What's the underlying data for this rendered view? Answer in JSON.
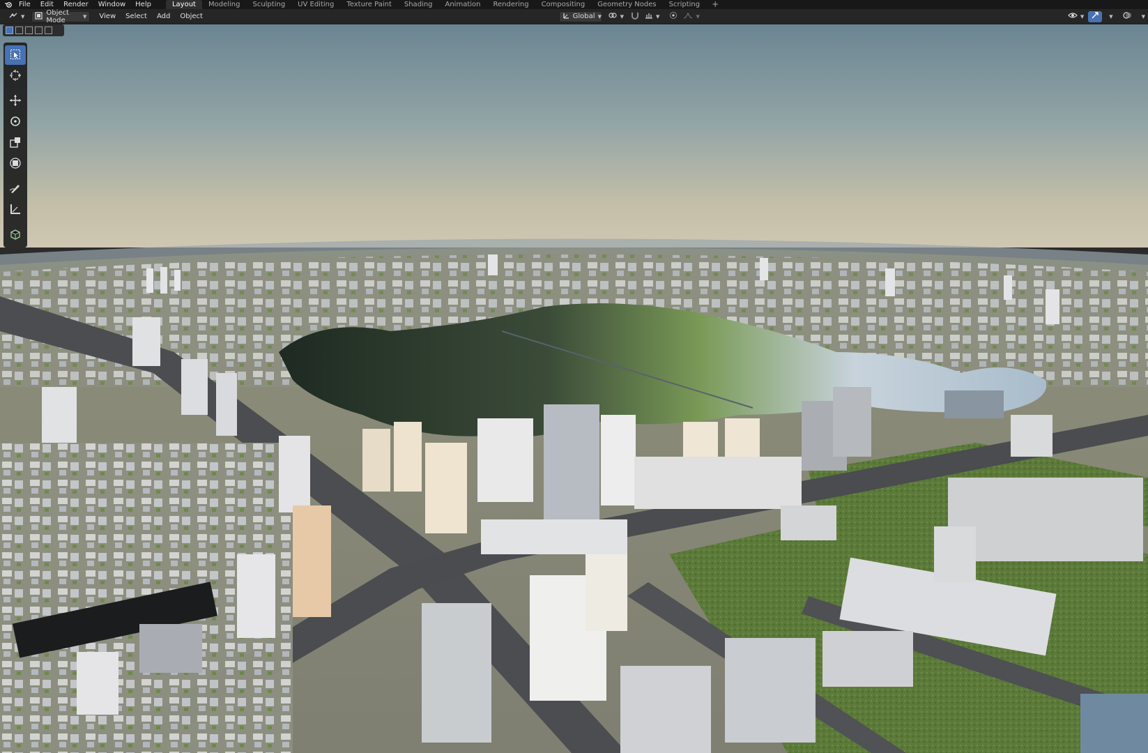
{
  "topbar": {
    "menus": [
      "File",
      "Edit",
      "Render",
      "Window",
      "Help"
    ],
    "workspaces": [
      "Layout",
      "Modeling",
      "Sculpting",
      "UV Editing",
      "Texture Paint",
      "Shading",
      "Animation",
      "Rendering",
      "Compositing",
      "Geometry Nodes",
      "Scripting"
    ],
    "active_workspace": "Layout",
    "add_label": "+"
  },
  "viewport_header": {
    "mode": "Object Mode",
    "menus": [
      "View",
      "Select",
      "Add",
      "Object"
    ],
    "orientation": "Global"
  },
  "toolshelf": {
    "tools": [
      "select-box",
      "cursor",
      "move",
      "rotate",
      "scale",
      "transform",
      "annotate",
      "measure",
      "add-cube"
    ],
    "active_tool": "select-box"
  },
  "colors": {
    "accent": "#4772b3",
    "sky_top": "#6d8795",
    "sky_horizon": "#c9c0a8",
    "grass": "#5b7a3a",
    "water": "#9fb6c9"
  }
}
